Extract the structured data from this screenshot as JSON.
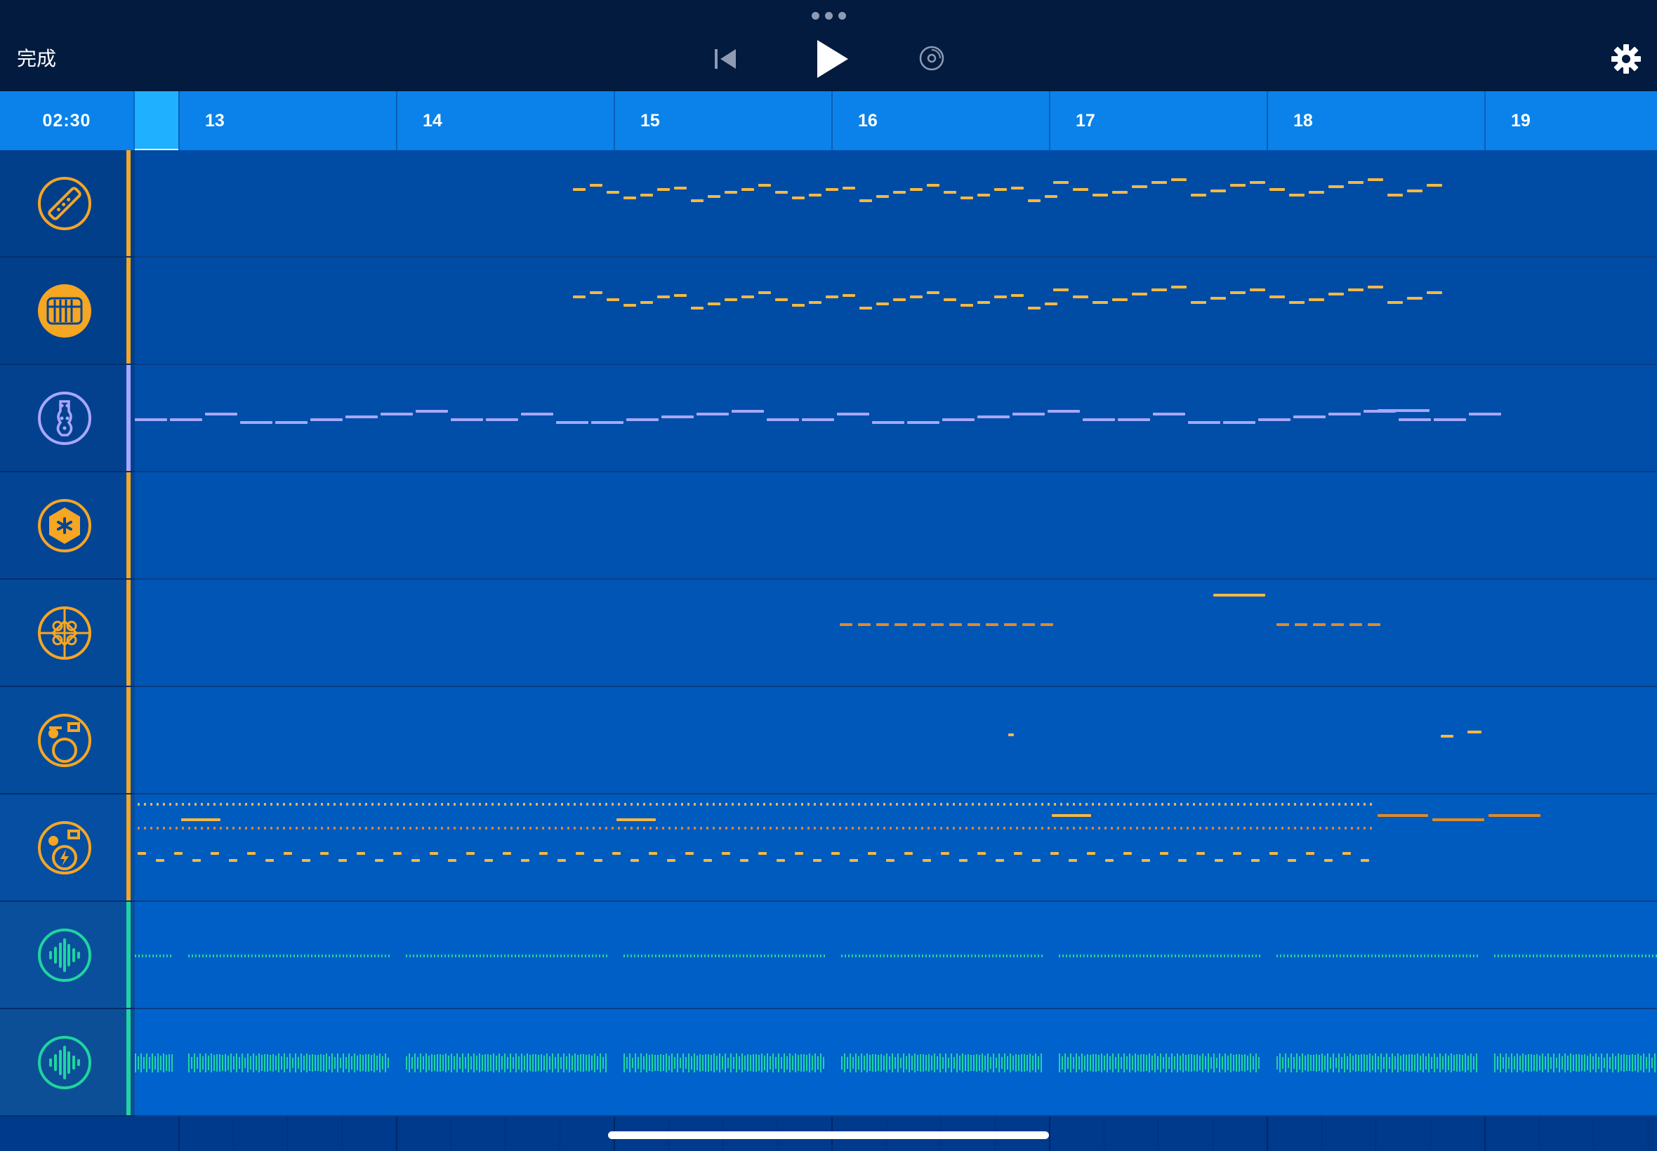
{
  "topbar": {
    "done_label": "完成",
    "icons": [
      "more-dots-icon",
      "rewind-icon",
      "play-icon",
      "record-icon",
      "gear-icon"
    ]
  },
  "ruler": {
    "time": "02:30",
    "bars": [
      "13",
      "14",
      "15",
      "16",
      "17",
      "18",
      "19"
    ]
  },
  "tracks": [
    {
      "name": "dizi",
      "icon": "flute-icon",
      "kind": "midi",
      "color": "#f5a623"
    },
    {
      "name": "pipa",
      "icon": "pipa-icon",
      "kind": "midi",
      "color": "#f5a623"
    },
    {
      "name": "bass",
      "icon": "bass-guitar-icon",
      "kind": "midi",
      "color": "#a9a7ff"
    },
    {
      "name": "percussion",
      "icon": "hexagon-star-icon",
      "kind": "midi",
      "color": "#f5a623"
    },
    {
      "name": "knot",
      "icon": "chinese-knot-icon",
      "kind": "midi",
      "color": "#f5a623"
    },
    {
      "name": "drums",
      "icon": "drum-kit-icon",
      "kind": "midi",
      "color": "#f5a623"
    },
    {
      "name": "electronic-drums",
      "icon": "electronic-drum-icon",
      "kind": "midi",
      "color": "#f5a623"
    },
    {
      "name": "audio-1",
      "icon": "waveform-icon",
      "kind": "audio",
      "color": "#1fd4a0"
    },
    {
      "name": "audio-2",
      "icon": "waveform-icon",
      "kind": "audio",
      "color": "#1fd4a0"
    }
  ]
}
